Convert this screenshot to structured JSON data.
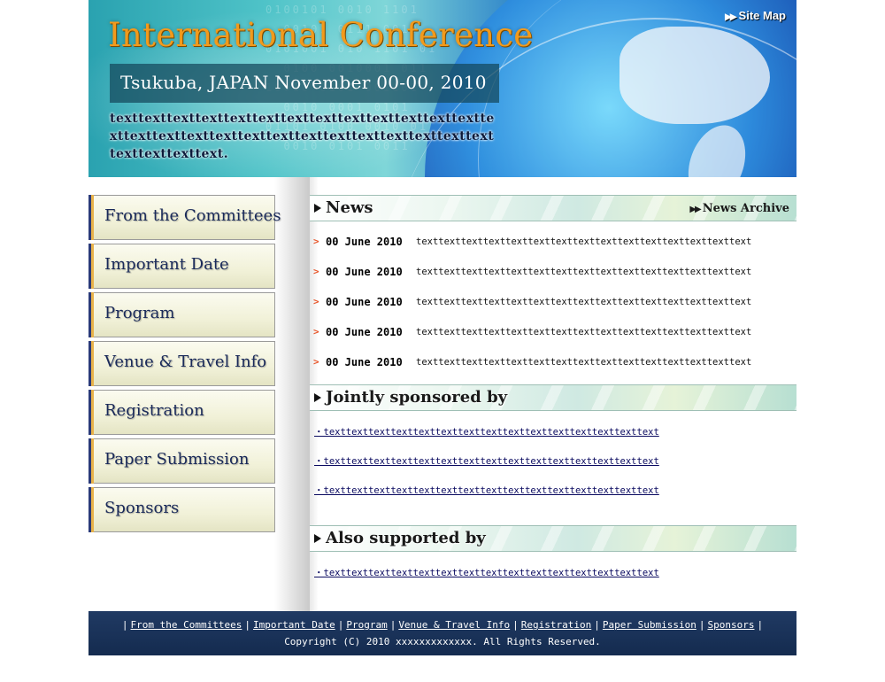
{
  "header": {
    "site_map": "Site Map",
    "title": "International Conference",
    "subtitle": "Tsukuba, JAPAN November 00-00, 2010",
    "intro": "texttexttexttexttexttexttexttexttexttexttexttexttexttexttexttexttexttexttexttexttexttexttexttexttexttexttexttexttexttexttext."
  },
  "nav": {
    "items": [
      {
        "label": "From the Committees"
      },
      {
        "label": "Important Date"
      },
      {
        "label": "Program"
      },
      {
        "label": "Venue & Travel Info"
      },
      {
        "label": "Registration"
      },
      {
        "label": "Paper Submission"
      },
      {
        "label": "Sponsors"
      }
    ]
  },
  "news": {
    "title": "News",
    "archive": "News Archive",
    "items": [
      {
        "date": "00 June 2010",
        "text": "texttexttexttexttexttexttexttexttexttexttexttexttexttexttext"
      },
      {
        "date": "00 June 2010",
        "text": "texttexttexttexttexttexttexttexttexttexttexttexttexttexttext"
      },
      {
        "date": "00 June 2010",
        "text": "texttexttexttexttexttexttexttexttexttexttexttexttexttexttext"
      },
      {
        "date": "00 June 2010",
        "text": "texttexttexttexttexttexttexttexttexttexttexttexttexttexttext"
      },
      {
        "date": "00 June 2010",
        "text": "texttexttexttexttexttexttexttexttexttexttexttexttexttexttext"
      }
    ]
  },
  "jointly": {
    "title": "Jointly sponsored by",
    "items": [
      {
        "text": "・texttexttexttexttexttexttexttexttexttexttexttexttexttexttext"
      },
      {
        "text": "・texttexttexttexttexttexttexttexttexttexttexttexttexttexttext"
      },
      {
        "text": "・texttexttexttexttexttexttexttexttexttexttexttexttexttexttext"
      }
    ]
  },
  "also": {
    "title": "Also supported by",
    "items": [
      {
        "text": "・texttexttexttexttexttexttexttexttexttexttexttexttexttexttext"
      }
    ]
  },
  "footer": {
    "links": [
      "From the Committees",
      "Important Date",
      "Program",
      "Venue & Travel Info",
      "Registration",
      "Paper Submission",
      "Sponsors"
    ],
    "separator": "|",
    "copyright": "Copyright (C) 2010 xxxxxxxxxxxxx. All Rights Reserved."
  },
  "colors": {
    "title_orange": "#f29a1c",
    "nav_text": "#1a2a5a",
    "footer_bg": "#142b4f",
    "news_bullet": "#e8562a"
  }
}
